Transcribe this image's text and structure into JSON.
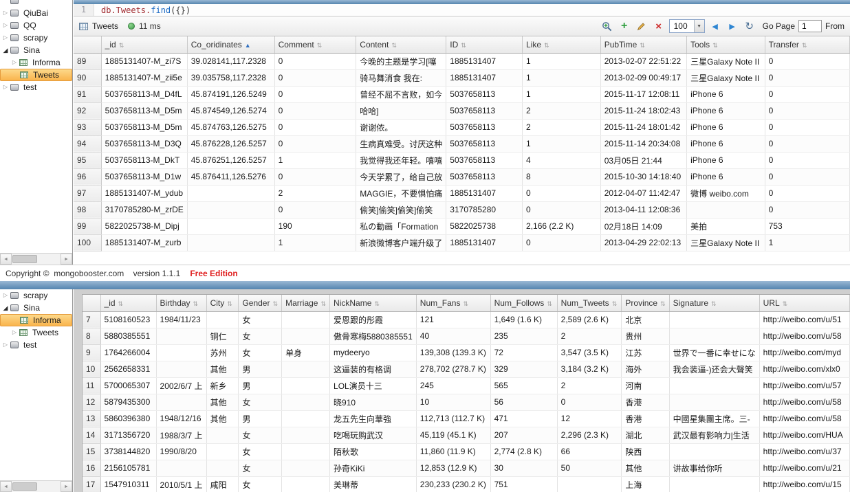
{
  "query_editor": {
    "line_number": "1",
    "tokens": [
      {
        "text": "db.Tweets.",
        "color": "#a0282d"
      },
      {
        "text": "find",
        "color": "#1b6ac4"
      },
      {
        "text": "({})",
        "color": "#333333"
      }
    ]
  },
  "toolbar": {
    "collection_label": "Tweets",
    "time_label": "11 ms",
    "page_size_value": "100",
    "dropdown_arrow": "▼",
    "prev_arrow": "◀",
    "next_arrow": "▶",
    "refresh_glyph": "↻",
    "add_glyph": "+",
    "delete_glyph": "×",
    "go_page_label": "Go Page",
    "page_input_value": "1",
    "from_label": "From"
  },
  "footer": {
    "copyright": "Copyright ©  mongobooster.com    version 1.1.1",
    "edition": "Free Edition"
  },
  "sidebar_top": {
    "items": [
      {
        "label": "",
        "level": 0,
        "expander": "none",
        "icon": "db",
        "selected": false
      },
      {
        "label": "QiuBai",
        "level": 0,
        "expander": "collapsed",
        "icon": "db",
        "selected": false
      },
      {
        "label": "QQ",
        "level": 0,
        "expander": "collapsed",
        "icon": "db",
        "selected": false
      },
      {
        "label": "scrapy",
        "level": 0,
        "expander": "collapsed",
        "icon": "db",
        "selected": false
      },
      {
        "label": "Sina",
        "level": 0,
        "expander": "expanded",
        "icon": "db",
        "selected": false
      },
      {
        "label": "Informa",
        "level": 1,
        "expander": "collapsed",
        "icon": "table",
        "selected": false
      },
      {
        "label": "Tweets",
        "level": 1,
        "expander": "none",
        "icon": "table",
        "selected": true
      },
      {
        "label": "test",
        "level": 0,
        "expander": "collapsed",
        "icon": "db",
        "selected": false
      }
    ]
  },
  "sidebar_bottom": {
    "items": [
      {
        "label": "scrapy",
        "level": 0,
        "expander": "collapsed",
        "icon": "db",
        "selected": false
      },
      {
        "label": "Sina",
        "level": 0,
        "expander": "expanded",
        "icon": "db",
        "selected": false
      },
      {
        "label": "Informa",
        "level": 1,
        "expander": "none",
        "icon": "table",
        "selected": true
      },
      {
        "label": "Tweets",
        "level": 1,
        "expander": "collapsed",
        "icon": "table",
        "selected": false
      },
      {
        "label": "test",
        "level": 0,
        "expander": "collapsed",
        "icon": "db",
        "selected": false
      }
    ]
  },
  "tweets_table": {
    "columns": [
      {
        "label": "_id",
        "sort": "both"
      },
      {
        "label": "Co_oridinates",
        "sort": "asc"
      },
      {
        "label": "Comment",
        "sort": "both"
      },
      {
        "label": "Content",
        "sort": "both"
      },
      {
        "label": "ID",
        "sort": "both"
      },
      {
        "label": "Like",
        "sort": "both"
      },
      {
        "label": "PubTime",
        "sort": "both"
      },
      {
        "label": "Tools",
        "sort": "both"
      },
      {
        "label": "Transfer",
        "sort": "both"
      }
    ],
    "rows": [
      {
        "num": "89",
        "cells": [
          "1885131407-M_zi7S",
          "39.028141,117.2328",
          "0",
          "今晚的主题是学习[噻",
          "1885131407",
          "1",
          "2013-02-07 22:51:22",
          "三星Galaxy Note II",
          "0"
        ]
      },
      {
        "num": "90",
        "cells": [
          "1885131407-M_zii5e",
          "39.035758,117.2328",
          "0",
          "骑马舞消食 我在:",
          "1885131407",
          "1",
          "2013-02-09 00:49:17",
          "三星Galaxy Note II",
          "0"
        ]
      },
      {
        "num": "91",
        "cells": [
          "5037658113-M_D4fL",
          "45.874191,126.5249",
          "0",
          "曾经不屈不言败，如今",
          "5037658113",
          "1",
          "2015-11-17 12:08:11",
          "iPhone 6",
          "0"
        ]
      },
      {
        "num": "92",
        "cells": [
          "5037658113-M_D5m",
          "45.874549,126.5274",
          "0",
          "哈哈]",
          "5037658113",
          "2",
          "2015-11-24 18:02:43",
          "iPhone 6",
          "0"
        ]
      },
      {
        "num": "93",
        "cells": [
          "5037658113-M_D5m",
          "45.874763,126.5275",
          "0",
          "谢谢侬。",
          "5037658113",
          "2",
          "2015-11-24 18:01:42",
          "iPhone 6",
          "0"
        ]
      },
      {
        "num": "94",
        "cells": [
          "5037658113-M_D3Q",
          "45.876228,126.5257",
          "0",
          "生病真难受。讨厌这种",
          "5037658113",
          "1",
          "2015-11-14 20:34:08",
          "iPhone 6",
          "0"
        ]
      },
      {
        "num": "95",
        "cells": [
          "5037658113-M_DkT",
          "45.876251,126.5257",
          "1",
          "我觉得我还年轻。嘻嘻",
          "5037658113",
          "4",
          "03月05日 21:44",
          "iPhone 6",
          "0"
        ]
      },
      {
        "num": "96",
        "cells": [
          "5037658113-M_D1w",
          "45.876411,126.5276",
          "0",
          "今天学累了，给自己放",
          "5037658113",
          "8",
          "2015-10-30 14:18:40",
          "iPhone 6",
          "0"
        ]
      },
      {
        "num": "97",
        "cells": [
          "1885131407-M_ydub",
          "",
          "2",
          "MAGGIE，不要惧怕痛",
          "1885131407",
          "0",
          "2012-04-07 11:42:47",
          "微博 weibo.com",
          "0"
        ]
      },
      {
        "num": "98",
        "cells": [
          "3170785280-M_zrDE",
          "",
          "0",
          "偷笑]偷笑]偷笑]偷笑",
          "3170785280",
          "0",
          "2013-04-11 12:08:36",
          "",
          "0"
        ]
      },
      {
        "num": "99",
        "cells": [
          "5822025738-M_Dipj",
          "",
          "190",
          "私の動画「Formation",
          "5822025738",
          "2,166 (2.2 K)",
          "02月18日 14:09",
          "美拍",
          "753"
        ]
      },
      {
        "num": "100",
        "cells": [
          "1885131407-M_zurb",
          "",
          "1",
          "新浪微博客户端升级了",
          "1885131407",
          "0",
          "2013-04-29 22:02:13",
          "三星Galaxy Note II",
          "1"
        ]
      }
    ]
  },
  "users_table": {
    "columns": [
      {
        "label": "_id",
        "sort": "both"
      },
      {
        "label": "Birthday",
        "sort": "both"
      },
      {
        "label": "City",
        "sort": "both"
      },
      {
        "label": "Gender",
        "sort": "both"
      },
      {
        "label": "Marriage",
        "sort": "both"
      },
      {
        "label": "NickName",
        "sort": "both"
      },
      {
        "label": "Num_Fans",
        "sort": "both"
      },
      {
        "label": "Num_Follows",
        "sort": "both"
      },
      {
        "label": "Num_Tweets",
        "sort": "both"
      },
      {
        "label": "Province",
        "sort": "both"
      },
      {
        "label": "Signature",
        "sort": "both"
      },
      {
        "label": "URL",
        "sort": "both"
      }
    ],
    "rows": [
      {
        "num": "7",
        "cells": [
          "5108160523",
          "1984/11/23",
          "",
          "女",
          "",
          "爱恩跟的彤霞",
          "121",
          "1,649 (1.6 K)",
          "2,589 (2.6 K)",
          "北京",
          "",
          "http://weibo.com/u/51"
        ]
      },
      {
        "num": "8",
        "cells": [
          "5880385551",
          "",
          "铜仁",
          "女",
          "",
          "傲骨寒梅5880385551",
          "40",
          "235",
          "2",
          "贵州",
          "",
          "http://weibo.com/u/58"
        ]
      },
      {
        "num": "9",
        "cells": [
          "1764266004",
          "",
          "苏州",
          "女",
          "单身",
          "mydeeryo",
          "139,308 (139.3 K)",
          "72",
          "3,547 (3.5 K)",
          "江苏",
          "世界で一番に幸せにな",
          "http://weibo.com/myd"
        ]
      },
      {
        "num": "10",
        "cells": [
          "2562658331",
          "",
          "其他",
          "男",
          "",
          "这逼装的有格调",
          "278,702 (278.7 K)",
          "329",
          "3,184 (3.2 K)",
          "海外",
          "我会装逼-)还会大聲笑",
          "http://weibo.com/xlx0"
        ]
      },
      {
        "num": "11",
        "cells": [
          "5700065307",
          "2002/6/7 上",
          "新乡",
          "男",
          "",
          "LOL演员十三",
          "245",
          "565",
          "2",
          "河南",
          "",
          "http://weibo.com/u/57"
        ]
      },
      {
        "num": "12",
        "cells": [
          "5879435300",
          "",
          "其他",
          "女",
          "",
          "晓910",
          "10",
          "56",
          "0",
          "香港",
          "",
          "http://weibo.com/u/58"
        ]
      },
      {
        "num": "13",
        "cells": [
          "5860396380",
          "1948/12/16",
          "其他",
          "男",
          "",
          "龙五先生向華強",
          "112,713 (112.7 K)",
          "471",
          "12",
          "香港",
          "中國星集團主席。三-",
          "http://weibo.com/u/58"
        ]
      },
      {
        "num": "14",
        "cells": [
          "3171356720",
          "1988/3/7 上",
          "",
          "女",
          "",
          "吃喝玩购武汉",
          "45,119 (45.1 K)",
          "207",
          "2,296 (2.3 K)",
          "湖北",
          "武汉最有影响力|生活",
          "http://weibo.com/HUA"
        ]
      },
      {
        "num": "15",
        "cells": [
          "3738144820",
          "1990/8/20",
          "",
          "女",
          "",
          "陌秋歌",
          "11,860 (11.9 K)",
          "2,774 (2.8 K)",
          "66",
          "陕西",
          "",
          "http://weibo.com/u/37"
        ]
      },
      {
        "num": "16",
        "cells": [
          "2156105781",
          "",
          "",
          "女",
          "",
          "孙奇KiKi",
          "12,853 (12.9 K)",
          "30",
          "50",
          "其他",
          "讲故事给你听",
          "http://weibo.com/u/21"
        ]
      },
      {
        "num": "17",
        "cells": [
          "1547910311",
          "2010/5/1 上",
          "咸阳",
          "女",
          "",
          "美琳蒂",
          "230,233 (230.2 K)",
          "751",
          "",
          "上海",
          "",
          "http://weibo.com/u/15"
        ]
      }
    ]
  }
}
